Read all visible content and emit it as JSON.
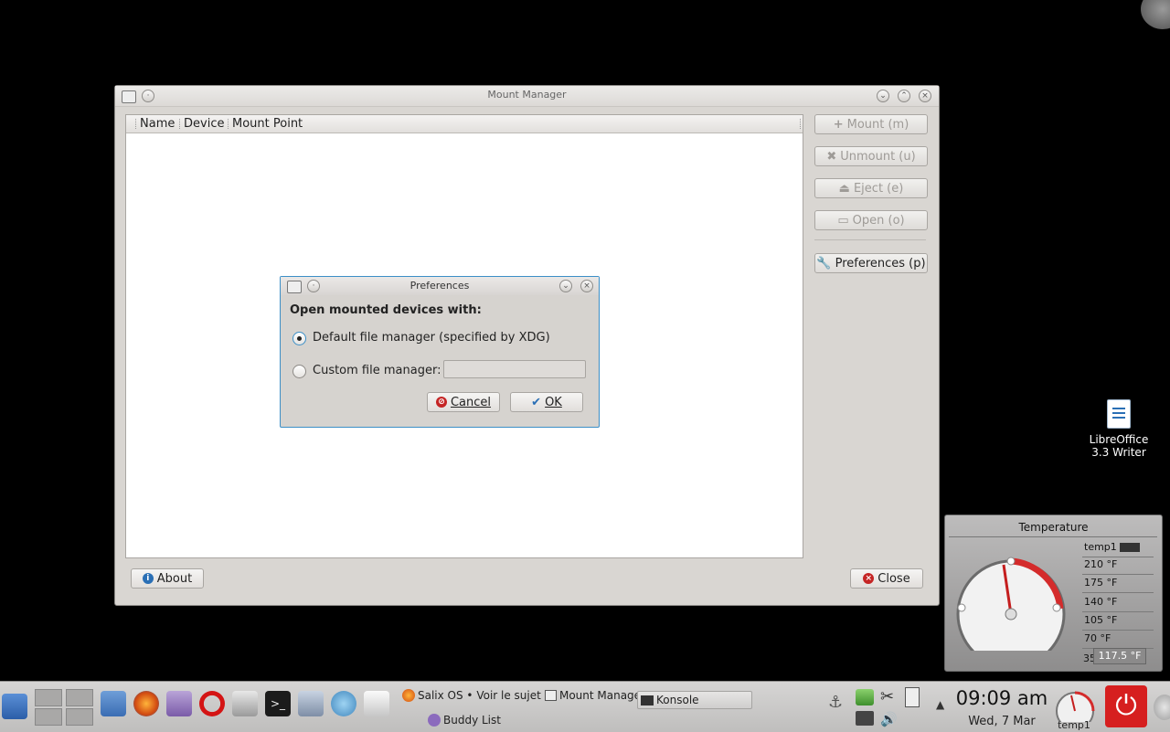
{
  "main_window": {
    "title": "Mount Manager",
    "columns": [
      "Name",
      "Device",
      "Mount Point"
    ],
    "buttons": {
      "mount": "Mount (m)",
      "unmount": "Unmount (u)",
      "eject": "Eject (e)",
      "open": "Open (o)",
      "preferences": "Preferences (p)",
      "about": "About",
      "close": "Close"
    }
  },
  "dialog": {
    "title": "Preferences",
    "heading": "Open mounted devices with:",
    "option_default": "Default file manager (specified by XDG)",
    "option_custom": "Custom file manager:",
    "custom_value": "",
    "selected": "default",
    "cancel": "Cancel",
    "ok": "OK"
  },
  "desktop": {
    "icon_label_line1": "LibreOffice",
    "icon_label_line2": "3.3 Writer"
  },
  "temperature_widget": {
    "title": "Temperature",
    "sensor": "temp1",
    "scale": [
      "210 °F",
      "175 °F",
      "140 °F",
      "105 °F",
      "70 °F"
    ],
    "scale_bottom": "35",
    "reading": "117.5 °F"
  },
  "taskbar": {
    "tasks": [
      "Salix OS • Voir le sujet",
      "Mount Manager",
      "Konsole",
      "Buddy List"
    ],
    "clock_time": "09:09 am",
    "clock_date": "Wed, 7 Mar",
    "gauge_label": "temp1"
  }
}
